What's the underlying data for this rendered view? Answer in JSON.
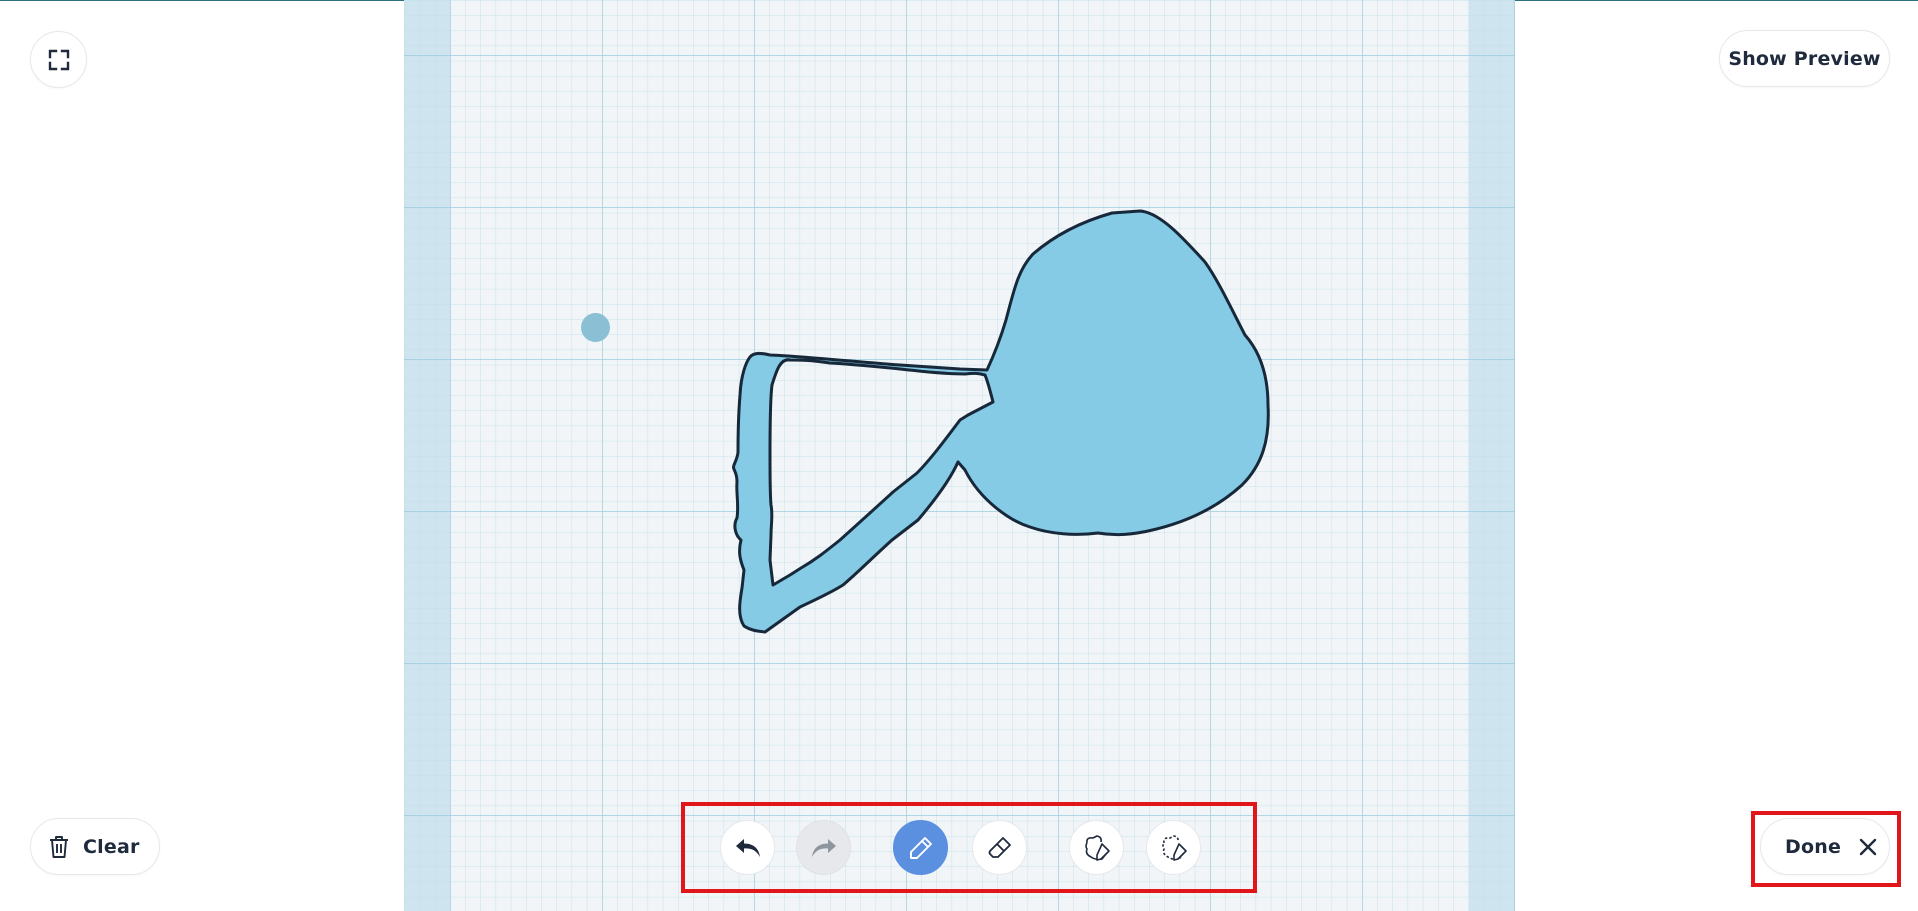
{
  "toolbar_top": {
    "fullscreen_icon": "fullscreen-expand-icon",
    "show_preview_label": "Show Preview"
  },
  "drawing_tools": {
    "undo_icon": "undo-icon",
    "redo_icon": "redo-icon",
    "redo_enabled": false,
    "pencil_icon": "pencil-icon",
    "pencil_active": true,
    "eraser_icon": "eraser-icon",
    "add_shape_icon": "add-shape-pencil-icon",
    "cut_shape_icon": "cut-shape-pencil-icon"
  },
  "bottom": {
    "clear_label": "Clear",
    "clear_icon": "trash-icon",
    "done_label": "Done",
    "done_icon": "close-icon"
  },
  "colors": {
    "shape_fill": "#85cbe5",
    "shape_stroke": "#17283a",
    "active_tool": "#5b8fe0",
    "highlight": "#e0161b",
    "canvas_bg": "#f1f5f7",
    "grid_line": "#a9d3e4"
  }
}
